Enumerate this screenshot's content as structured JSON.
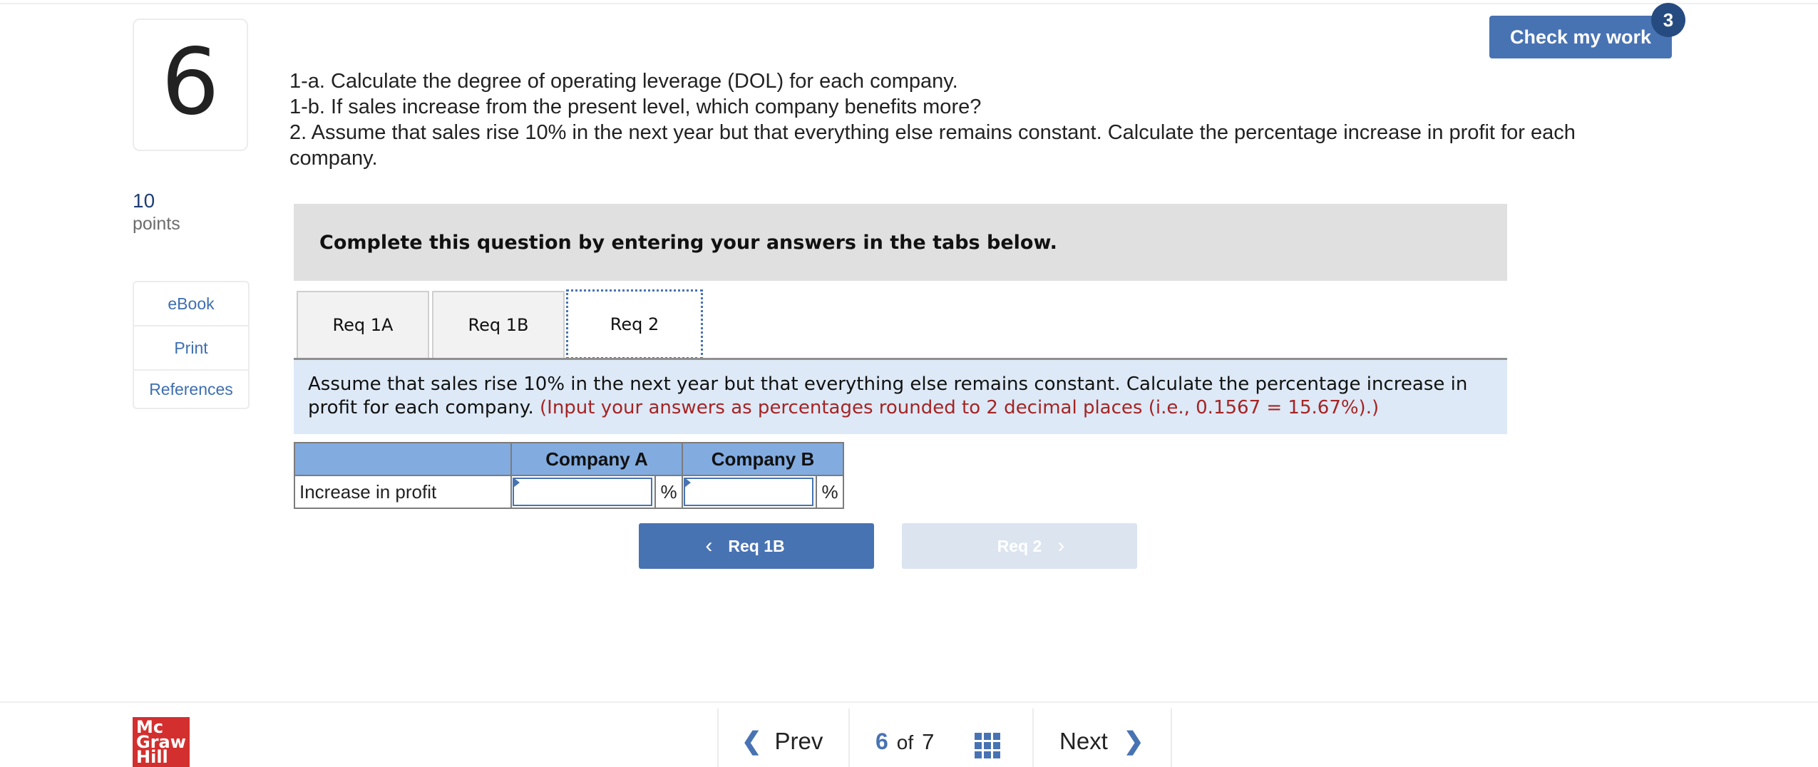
{
  "question": {
    "number": "6",
    "points_value": "10",
    "points_label": "points",
    "instructions": [
      "1-a. Calculate the degree of operating leverage (DOL) for each company.",
      "1-b. If sales increase from the present level, which company benefits more?",
      "2. Assume that sales rise 10% in the next year but that everything else remains constant. Calculate the percentage increase in profit for each company."
    ]
  },
  "sidebar": {
    "links": [
      {
        "label": "eBook"
      },
      {
        "label": "Print"
      },
      {
        "label": "References"
      }
    ]
  },
  "header": {
    "check_button_label": "Check my work",
    "check_badge_count": "3"
  },
  "banner": {
    "text": "Complete this question by entering your answers in the tabs below."
  },
  "tabs": [
    {
      "label": "Req 1A",
      "active": false
    },
    {
      "label": "Req 1B",
      "active": false
    },
    {
      "label": "Req 2",
      "active": true
    }
  ],
  "requirement": {
    "text": "Assume that sales rise 10% in the next year but that everything else remains constant. Calculate the percentage increase in profit for each company.",
    "note": "(Input your answers as percentages rounded to 2 decimal places (i.e., 0.1567 = 15.67%).)"
  },
  "answer_table": {
    "columns": [
      "",
      "Company A",
      "Company B"
    ],
    "rows": [
      {
        "label": "Increase in profit",
        "company_a_value": "",
        "company_b_value": "",
        "unit": "%"
      }
    ]
  },
  "req_nav": {
    "prev_label": "Req 1B",
    "next_label": "Req 2",
    "next_disabled": true
  },
  "footer": {
    "logo_lines": [
      "Mc",
      "Graw",
      "Hill"
    ],
    "prev_label": "Prev",
    "next_label": "Next",
    "current_page": "6",
    "of_label": "of",
    "total_pages": "7"
  },
  "colors": {
    "brand_blue": "#4873b3",
    "badge_navy": "#264b80",
    "note_red": "#a52424",
    "logo_red": "#d32f2f",
    "table_header": "#82abe0",
    "req_background": "#dde9f6"
  }
}
